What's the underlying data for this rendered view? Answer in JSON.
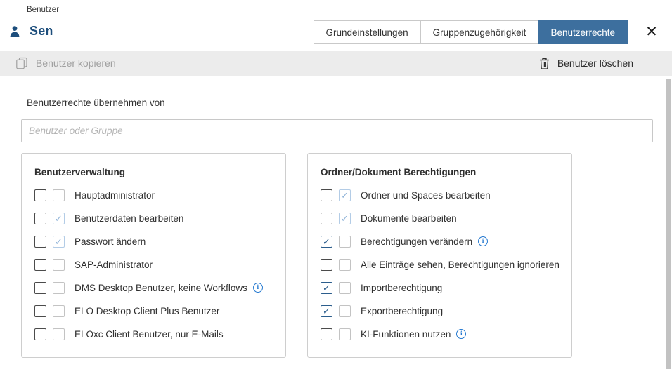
{
  "header": {
    "breadcrumb": "Benutzer",
    "title": "Sen",
    "tabs": [
      {
        "label": "Grundeinstellungen",
        "active": false
      },
      {
        "label": "Gruppenzugehörigkeit",
        "active": false
      },
      {
        "label": "Benutzerrechte",
        "active": true
      }
    ],
    "close_glyph": "✕"
  },
  "toolbar": {
    "copy_label": "Benutzer kopieren",
    "delete_label": "Benutzer löschen"
  },
  "form": {
    "inherit_label": "Benutzerrechte übernehmen von",
    "input_value": "",
    "input_placeholder": "Benutzer oder Gruppe"
  },
  "panels": [
    {
      "title": "Benutzerverwaltung",
      "rows": [
        {
          "label": "Hauptadministrator",
          "own": false,
          "inherited": false,
          "info": false
        },
        {
          "label": "Benutzerdaten bearbeiten",
          "own": false,
          "inherited": true,
          "info": false
        },
        {
          "label": "Passwort ändern",
          "own": false,
          "inherited": true,
          "info": false
        },
        {
          "label": "SAP-Administrator",
          "own": false,
          "inherited": false,
          "info": false
        },
        {
          "label": "DMS Desktop Benutzer, keine Workflows",
          "own": false,
          "inherited": false,
          "info": true
        },
        {
          "label": "ELO Desktop Client Plus Benutzer",
          "own": false,
          "inherited": false,
          "info": false
        },
        {
          "label": "ELOxc Client Benutzer, nur E-Mails",
          "own": false,
          "inherited": false,
          "info": false
        }
      ]
    },
    {
      "title": "Ordner/Dokument Berechtigungen",
      "rows": [
        {
          "label": "Ordner und Spaces bearbeiten",
          "own": false,
          "inherited": true,
          "info": false
        },
        {
          "label": "Dokumente bearbeiten",
          "own": false,
          "inherited": true,
          "info": false
        },
        {
          "label": "Berechtigungen verändern",
          "own": true,
          "inherited": false,
          "info": true
        },
        {
          "label": "Alle Einträge sehen, Berechtigungen ignorieren",
          "own": false,
          "inherited": false,
          "info": false
        },
        {
          "label": "Importberechtigung",
          "own": true,
          "inherited": false,
          "info": false
        },
        {
          "label": "Exportberechtigung",
          "own": true,
          "inherited": false,
          "info": false
        },
        {
          "label": "KI-Funktionen nutzen",
          "own": false,
          "inherited": false,
          "info": true
        }
      ]
    }
  ],
  "glyphs": {
    "check": "✓",
    "info": "i"
  },
  "colors": {
    "accent_tab": "#3d6f9e",
    "title_navy": "#1d4e7c",
    "checked_own": "#2b5d8c",
    "checked_inherited": "#8fb3d8",
    "info_blue": "#2579d0",
    "toolbar_bg": "#ececec",
    "disabled_text": "#a0a0a0",
    "scrollbar": "#c2c2c2"
  }
}
